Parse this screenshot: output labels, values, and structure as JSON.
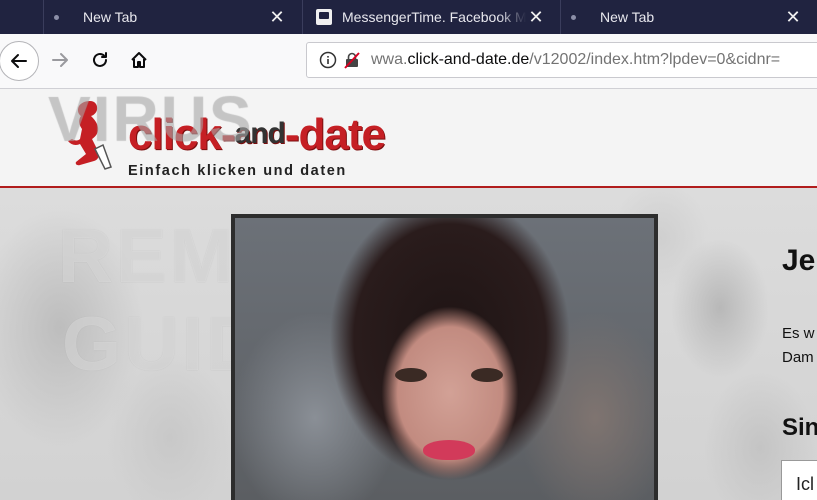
{
  "tabs": [
    {
      "label": "New Tab",
      "active": false
    },
    {
      "label": "MessengerTime. Facebook M",
      "active": false
    },
    {
      "label": "New Tab",
      "active": false
    }
  ],
  "url": {
    "prefix": "wwa.",
    "domain": "click-and-date.de",
    "path": "/v12002/index.htm?lpdev=0&cidnr="
  },
  "logo": {
    "word_left": "click-",
    "word_mid": "and",
    "word_right": "-date",
    "tagline": "Einfach klicken und daten"
  },
  "watermark": [
    "VIRUS",
    "REMOVAL",
    "GUIDE"
  ],
  "side": {
    "heading": "Je",
    "line1": "Es w",
    "line2": "Dam",
    "subheading": "Sin",
    "box_text": "Icl"
  },
  "colors": {
    "brand_red": "#c51f24",
    "tab_bg": "#202340"
  }
}
